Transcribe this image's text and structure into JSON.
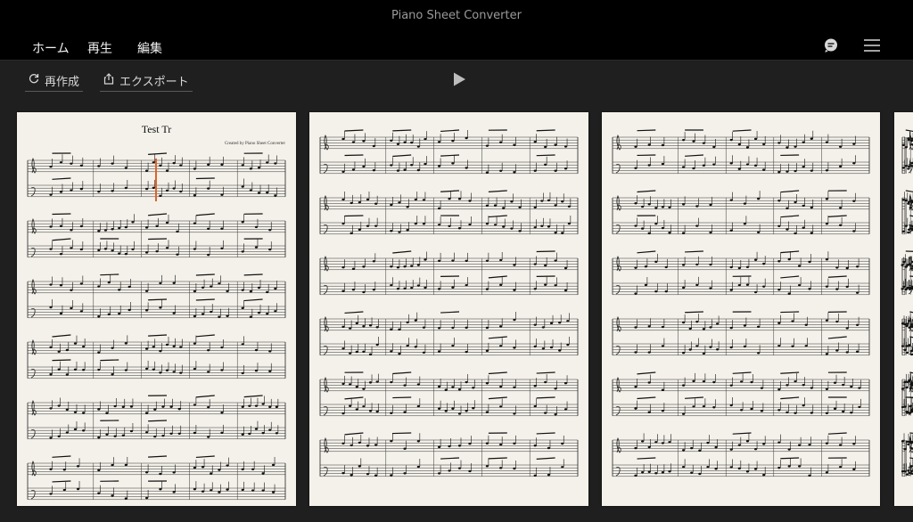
{
  "app": {
    "title": "Piano Sheet Converter"
  },
  "nav": {
    "tabs": [
      {
        "label": "ホーム",
        "active": false
      },
      {
        "label": "再生",
        "active": true
      },
      {
        "label": "編集",
        "active": false
      }
    ],
    "icons": [
      "feedback-icon",
      "menu-icon"
    ]
  },
  "toolbar": {
    "regenerate_label": "再作成",
    "export_label": "エクスポート"
  },
  "score": {
    "title": "Test Tr",
    "credit": "Created by Piano Sheet Converter"
  },
  "colors": {
    "accent": "#e0622b",
    "paper": "#f4f1ea",
    "background": "#1f1f1f",
    "titlebar": "#000000"
  }
}
